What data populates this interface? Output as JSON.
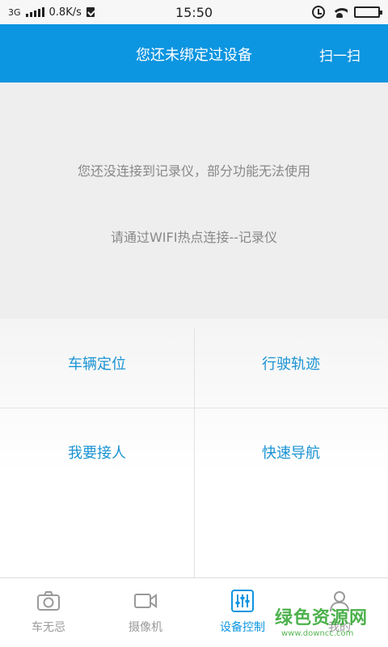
{
  "status_bar": {
    "network": "3G",
    "speed": "0.8K/s",
    "time": "15:50"
  },
  "header": {
    "title": "您还未绑定过设备",
    "scan_label": "扫一扫"
  },
  "notice": {
    "line1": "您还没连接到记录仪，部分功能无法使用",
    "line2": "请通过WIFI热点连接--记录仪"
  },
  "grid": {
    "items": [
      {
        "label": "车辆定位"
      },
      {
        "label": "行驶轨迹"
      },
      {
        "label": "我要接人"
      },
      {
        "label": "快速导航"
      }
    ]
  },
  "tabs": [
    {
      "label": "车无忌",
      "icon": "camera-icon",
      "active": false
    },
    {
      "label": "摄像机",
      "icon": "video-camera-icon",
      "active": false
    },
    {
      "label": "设备控制",
      "icon": "sliders-icon",
      "active": true
    },
    {
      "label": "我的",
      "icon": "user-icon",
      "active": false
    }
  ],
  "watermark": {
    "name": "绿色资源网",
    "url": "www.downcc.com"
  },
  "colors": {
    "brand": "#0c95e0",
    "link": "#1a93d4",
    "watermark": "#3aa93a"
  }
}
